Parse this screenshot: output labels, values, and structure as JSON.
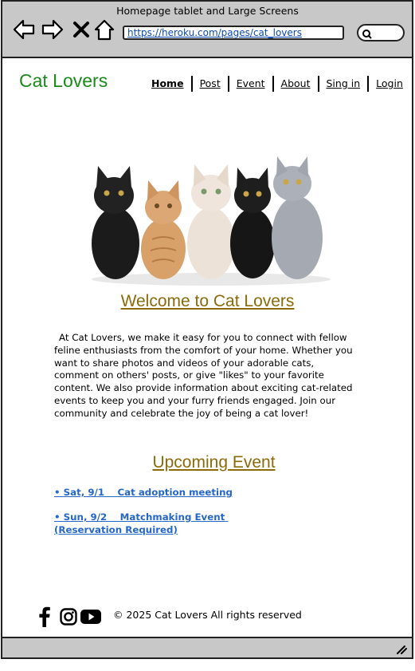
{
  "window": {
    "title": "Homepage tablet and Large Screens"
  },
  "browser": {
    "url": "https://heroku.com/pages/cat_lovers"
  },
  "site": {
    "logo": "Cat Lovers"
  },
  "nav": {
    "items": [
      "Home",
      "Post",
      "Event",
      "About",
      "Sing in",
      "Login"
    ]
  },
  "hero": {
    "image": "row-of-five-kittens"
  },
  "welcome": {
    "heading": "Welcome to Cat Lovers",
    "body": "At Cat Lovers, we make it easy for you to connect with fellow feline enthusiasts from the comfort of your home. Whether you want to share photos and videos of your adorable cats, comment on others' posts, or give \"likes\" to your favorite content. We also provide information about exciting cat-related events to keep you and your furry friends engaged. Join our community and celebrate the joy of being a cat lover!"
  },
  "events": {
    "heading": "Upcoming Event",
    "items": [
      "• Sat, 9/1    Cat adoption meeting",
      "• Sun, 9/2    Matchmaking Event (Reservation Required)"
    ]
  },
  "footer": {
    "icons": [
      "facebook-icon",
      "instagram-icon",
      "youtube-icon"
    ],
    "copyright": "© 2025 Cat Lovers All rights reserved"
  },
  "colors": {
    "logo": "#1a8a1a",
    "heading": "#8b6a0a",
    "link": "#2566c9",
    "chrome": "#c8c8c8"
  }
}
